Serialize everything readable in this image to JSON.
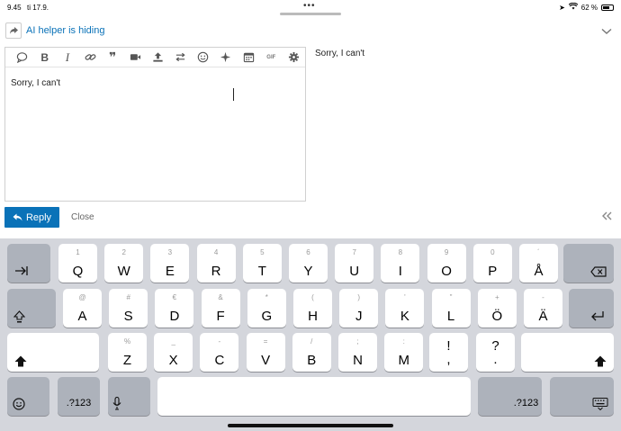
{
  "status": {
    "time": "9.45",
    "date": "ti 17.9.",
    "battery": "62 %"
  },
  "reply": {
    "topic_title": "AI helper is hiding",
    "draft_text": "Sorry, I can't",
    "preview_text": "Sorry, I can't",
    "reply_label": "Reply",
    "close_label": "Close",
    "toolbar": [
      "emoji-chat-bubble",
      "bold",
      "italic",
      "link",
      "quote",
      "video",
      "upload",
      "transfer",
      "emoji",
      "ai-sparkle",
      "calendar",
      "gif",
      "settings"
    ],
    "gif_label": "GIF"
  },
  "keyboard": {
    "row1": [
      {
        "main": "Q",
        "sub": "1"
      },
      {
        "main": "W",
        "sub": "2"
      },
      {
        "main": "E",
        "sub": "3"
      },
      {
        "main": "R",
        "sub": "4"
      },
      {
        "main": "T",
        "sub": "5"
      },
      {
        "main": "Y",
        "sub": "6"
      },
      {
        "main": "U",
        "sub": "7"
      },
      {
        "main": "I",
        "sub": "8"
      },
      {
        "main": "O",
        "sub": "9"
      },
      {
        "main": "P",
        "sub": "0"
      },
      {
        "main": "Å",
        "sub": "´"
      }
    ],
    "row2": [
      {
        "main": "A",
        "sub": "@"
      },
      {
        "main": "S",
        "sub": "#"
      },
      {
        "main": "D",
        "sub": "€"
      },
      {
        "main": "F",
        "sub": "&"
      },
      {
        "main": "G",
        "sub": "*"
      },
      {
        "main": "H",
        "sub": "("
      },
      {
        "main": "J",
        "sub": ")"
      },
      {
        "main": "K",
        "sub": "'"
      },
      {
        "main": "L",
        "sub": "\""
      },
      {
        "main": "Ö",
        "sub": "+"
      },
      {
        "main": "Ä",
        "sub": "-"
      }
    ],
    "row3": [
      {
        "main": "Z",
        "sub": "%"
      },
      {
        "main": "X",
        "sub": "_"
      },
      {
        "main": "C",
        "sub": "-"
      },
      {
        "main": "V",
        "sub": "="
      },
      {
        "main": "B",
        "sub": "/"
      },
      {
        "main": "N",
        "sub": ";"
      },
      {
        "main": "M",
        "sub": ":"
      }
    ],
    "punct": [
      {
        "top": "!",
        "bottom": ","
      },
      {
        "top": "?",
        "bottom": "."
      }
    ],
    "numbers_label": ".?123",
    "numbers_label_right": ".?123"
  }
}
